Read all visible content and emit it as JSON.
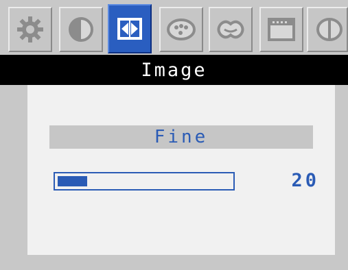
{
  "menu": {
    "title": "Image",
    "active_tab": "image",
    "tabs": [
      {
        "id": "brightness",
        "icon": "sun-icon"
      },
      {
        "id": "contrast",
        "icon": "contrast-icon"
      },
      {
        "id": "image",
        "icon": "image-icon"
      },
      {
        "id": "color",
        "icon": "palette-icon"
      },
      {
        "id": "sound",
        "icon": "sound-icon"
      },
      {
        "id": "settings",
        "icon": "window-icon"
      },
      {
        "id": "info",
        "icon": "info-icon"
      }
    ]
  },
  "setting": {
    "label": "Fine",
    "value": "20",
    "level_fraction": 0.2
  },
  "colors": {
    "accent": "#2a5bb5",
    "title_bg": "#000000",
    "panel_bg": "#f1f1f1",
    "bar_bg": "#c6c6c6"
  }
}
